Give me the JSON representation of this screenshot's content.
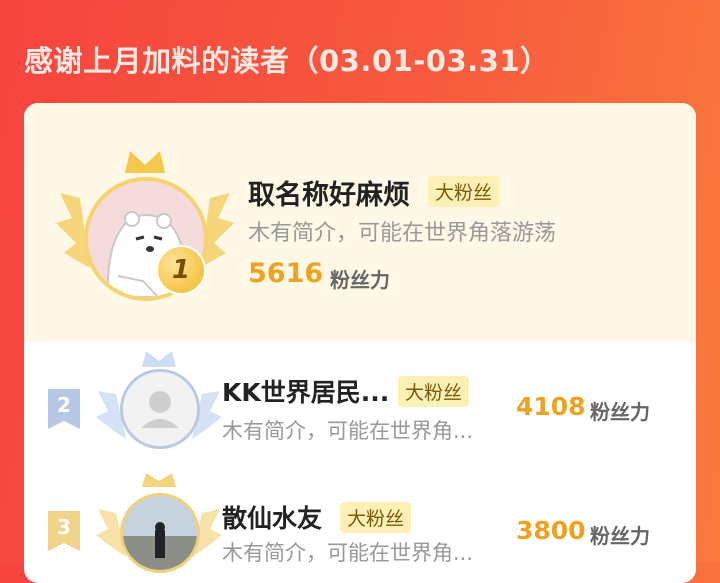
{
  "page_title": "感谢上月加料的读者（03.01-03.31）",
  "colors": {
    "background": "#f6443f",
    "score": "#f0a21f",
    "badge_bg": "#fff0b6",
    "top_card_bg": "#fff8e6"
  },
  "readers": [
    {
      "rank": "1",
      "name": "取名称好麻烦",
      "badge": "大粉丝",
      "bio": "木有简介，可能在世界角落游荡",
      "score": "5616",
      "unit": "粉丝力",
      "avatar_icon": "polar-bear-avatar"
    },
    {
      "rank": "2",
      "name": "KK世界居民...",
      "badge": "大粉丝",
      "bio": "木有简介，可能在世界角...",
      "score": "4108",
      "unit": "粉丝力",
      "avatar_icon": "default-person-avatar"
    },
    {
      "rank": "3",
      "name": "散仙水友",
      "badge": "大粉丝",
      "bio": "木有简介，可能在世界角...",
      "score": "3800",
      "unit": "粉丝力",
      "avatar_icon": "photo-avatar"
    }
  ]
}
